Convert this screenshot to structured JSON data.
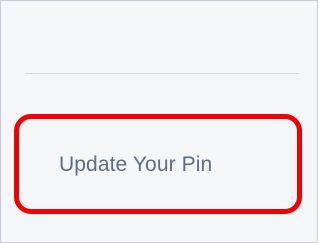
{
  "menu": {
    "update_pin_label": "Update Your Pin"
  },
  "colors": {
    "panel_background": "#f5f6f8",
    "link_text": "#5b6e86",
    "highlight": "#ee0000",
    "divider": "#d3d6db"
  }
}
